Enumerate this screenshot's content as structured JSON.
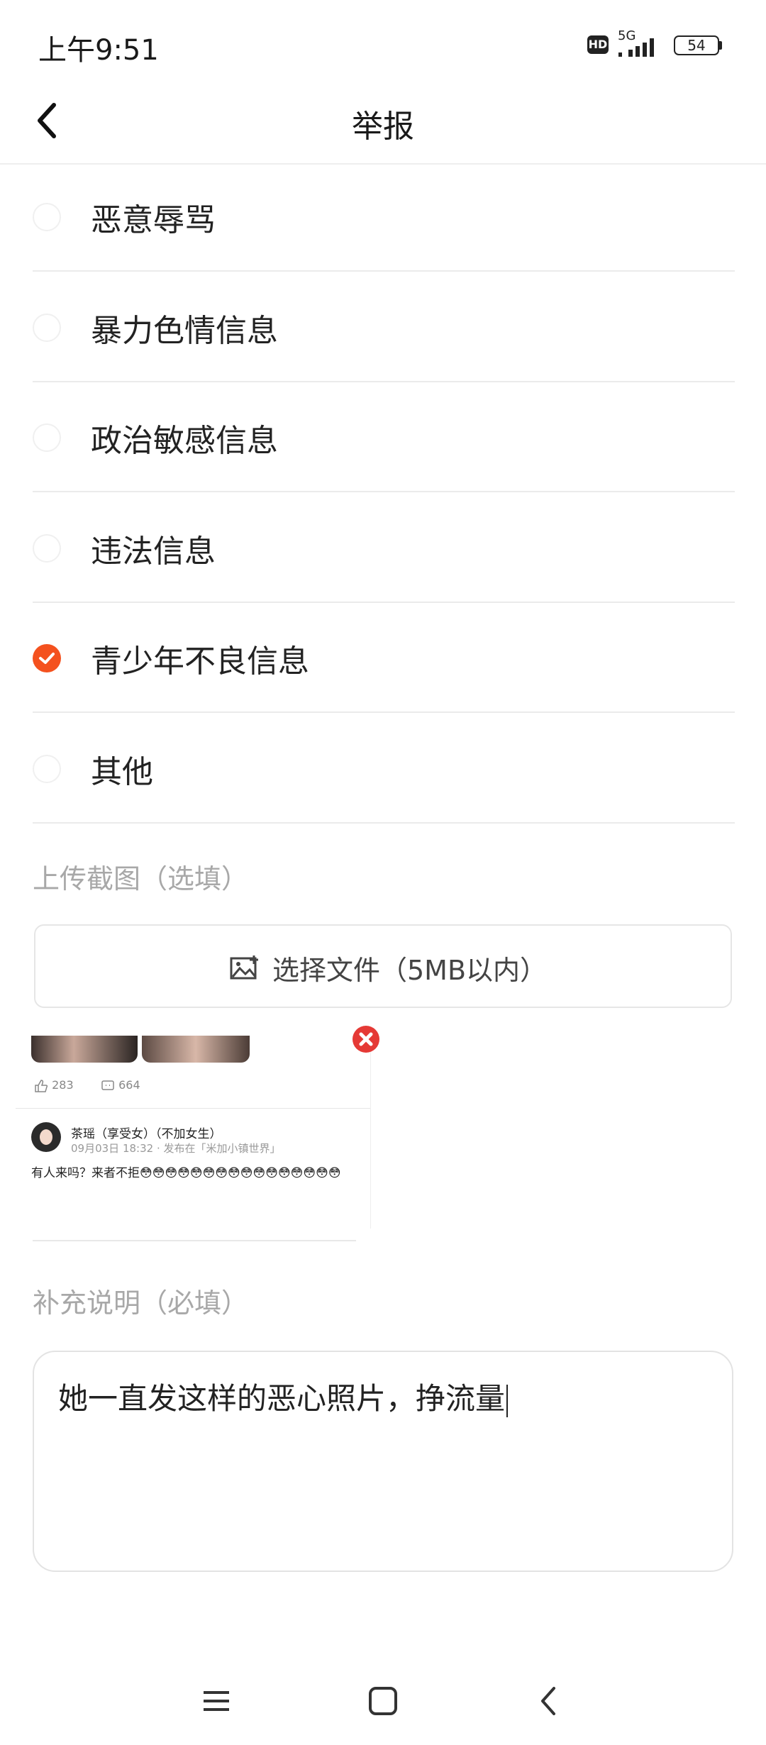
{
  "status": {
    "time": "上午9:51",
    "hd": "HD",
    "network": "5G",
    "battery": "54"
  },
  "header": {
    "title": "举报"
  },
  "reasons": [
    {
      "label": "恶意辱骂",
      "checked": false
    },
    {
      "label": "暴力色情信息",
      "checked": false
    },
    {
      "label": "政治敏感信息",
      "checked": false
    },
    {
      "label": "违法信息",
      "checked": false
    },
    {
      "label": "青少年不良信息",
      "checked": true
    },
    {
      "label": "其他",
      "checked": false
    }
  ],
  "upload": {
    "title": "上传截图（选填）",
    "button_label": "选择文件（5MB以内）"
  },
  "screenshot": {
    "likes": "283",
    "comments": "664",
    "author": "茶瑶（享受女）（不加女生）",
    "meta": "09月03日 18:32 · 发布在「米加小镇世界」",
    "body": "有人来吗？来者不拒😳😳😳😳😳😳😳😳😳😳😳😳😳😳😳😳"
  },
  "note": {
    "title": "补充说明（必填）",
    "value": "她一直发这样的恶心照片，挣流量"
  },
  "colors": {
    "accent": "#f4511e",
    "remove": "#e53935"
  },
  "icons": [
    "back-icon",
    "image-icon",
    "close-icon",
    "like-icon",
    "comment-icon",
    "menu-icon",
    "home-icon",
    "nav-back-icon"
  ]
}
